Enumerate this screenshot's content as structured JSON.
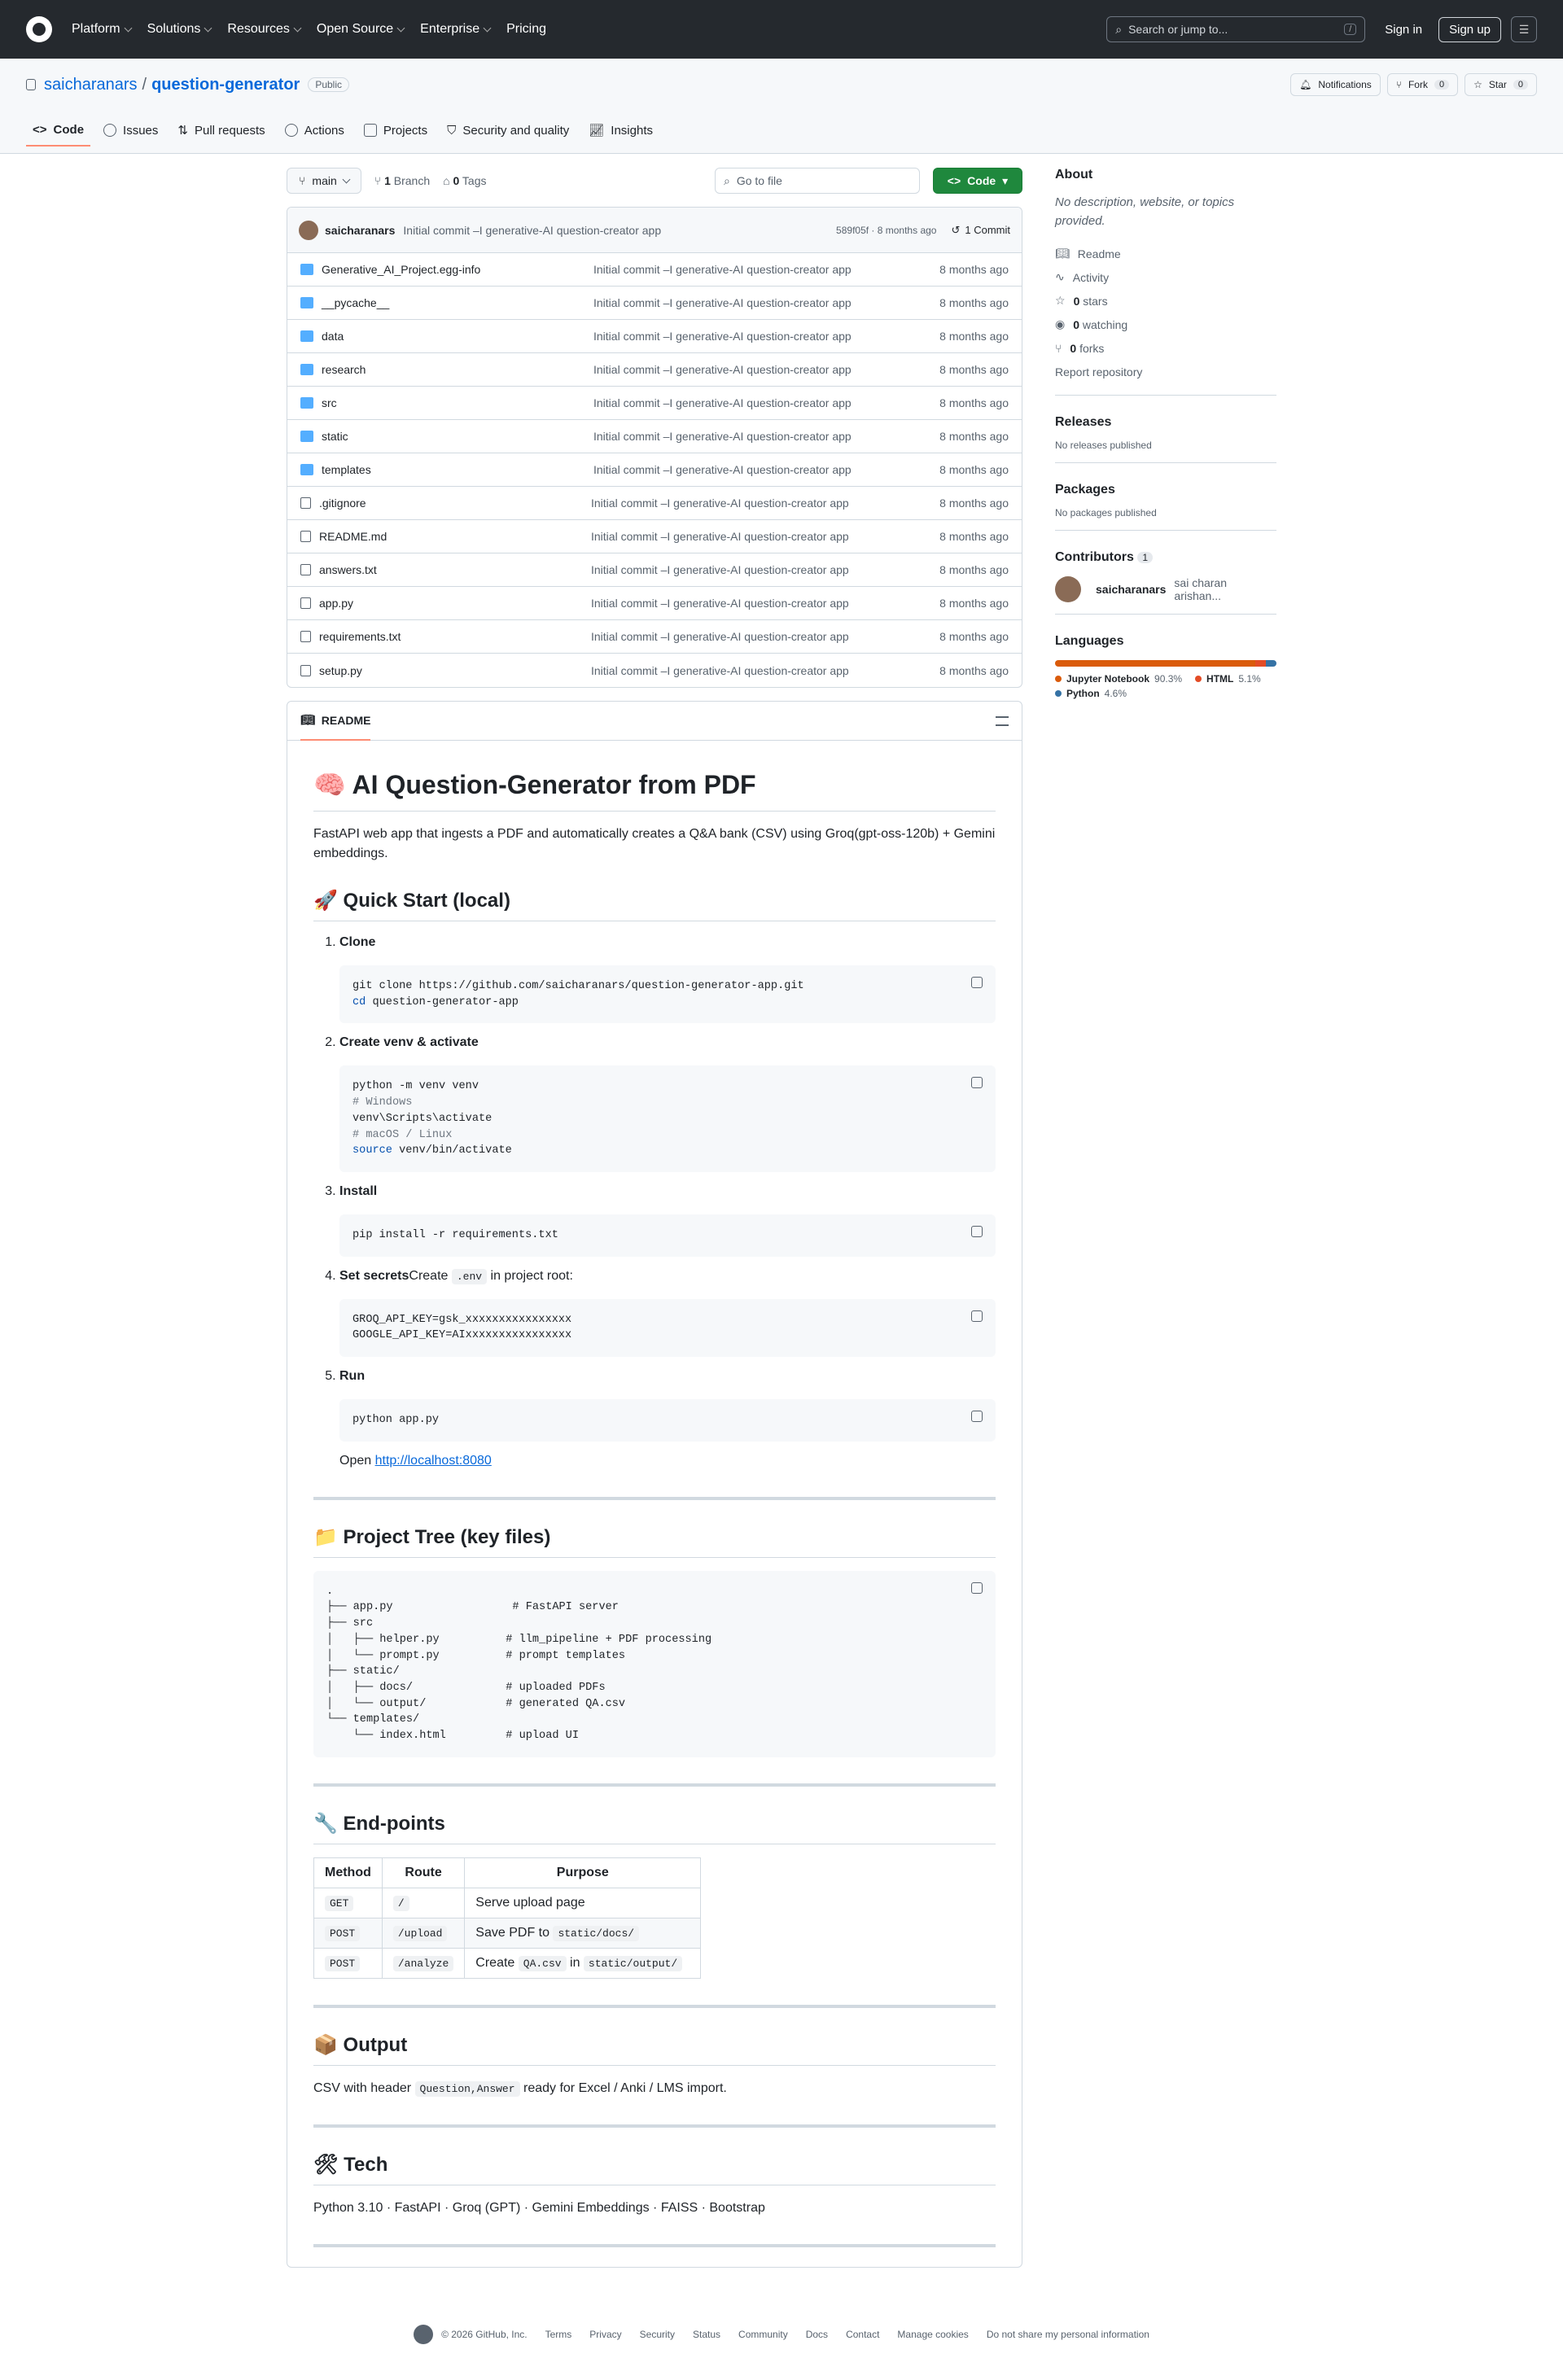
{
  "header": {
    "nav": [
      "Platform",
      "Solutions",
      "Resources",
      "Open Source",
      "Enterprise",
      "Pricing"
    ],
    "search_placeholder": "Search or jump to...",
    "search_kbd": "/",
    "sign_in": "Sign in",
    "sign_up": "Sign up"
  },
  "repo": {
    "owner": "saicharanars",
    "separator": "/",
    "name": "question-generator",
    "visibility": "Public",
    "notifications": "Notifications",
    "fork": "Fork",
    "fork_count": "0",
    "star": "Star",
    "star_count": "0",
    "tabs": [
      "Code",
      "Issues",
      "Pull requests",
      "Actions",
      "Projects",
      "Security and quality",
      "Insights"
    ]
  },
  "toolbar": {
    "branch": "main",
    "branches_count": "1",
    "branches_label": "Branch",
    "tags_count": "0",
    "tags_label": "Tags",
    "goto_placeholder": "Go to file",
    "code_button": "Code"
  },
  "commit": {
    "author": "saicharanars",
    "message": "Initial commit –I generative-AI question-creator app",
    "sha_time": "589f05f · 8 months ago",
    "count": "1 Commit"
  },
  "files": [
    {
      "name": "Generative_AI_Project.egg-info",
      "type": "dir",
      "msg": "Initial commit –I generative-AI question-creator app",
      "date": "8 months ago"
    },
    {
      "name": "__pycache__",
      "type": "dir",
      "msg": "Initial commit –I generative-AI question-creator app",
      "date": "8 months ago"
    },
    {
      "name": "data",
      "type": "dir",
      "msg": "Initial commit –I generative-AI question-creator app",
      "date": "8 months ago"
    },
    {
      "name": "research",
      "type": "dir",
      "msg": "Initial commit –I generative-AI question-creator app",
      "date": "8 months ago"
    },
    {
      "name": "src",
      "type": "dir",
      "msg": "Initial commit –I generative-AI question-creator app",
      "date": "8 months ago"
    },
    {
      "name": "static",
      "type": "dir",
      "msg": "Initial commit –I generative-AI question-creator app",
      "date": "8 months ago"
    },
    {
      "name": "templates",
      "type": "dir",
      "msg": "Initial commit –I generative-AI question-creator app",
      "date": "8 months ago"
    },
    {
      "name": ".gitignore",
      "type": "file",
      "msg": "Initial commit –I generative-AI question-creator app",
      "date": "8 months ago"
    },
    {
      "name": "README.md",
      "type": "file",
      "msg": "Initial commit –I generative-AI question-creator app",
      "date": "8 months ago"
    },
    {
      "name": "answers.txt",
      "type": "file",
      "msg": "Initial commit –I generative-AI question-creator app",
      "date": "8 months ago"
    },
    {
      "name": "app.py",
      "type": "file",
      "msg": "Initial commit –I generative-AI question-creator app",
      "date": "8 months ago"
    },
    {
      "name": "requirements.txt",
      "type": "file",
      "msg": "Initial commit –I generative-AI question-creator app",
      "date": "8 months ago"
    },
    {
      "name": "setup.py",
      "type": "file",
      "msg": "Initial commit –I generative-AI question-creator app",
      "date": "8 months ago"
    }
  ],
  "readme": {
    "tab": "README",
    "title": "🧠 AI Question-Generator from PDF",
    "intro": "FastAPI web app that ingests a PDF and automatically creates a Q&A bank (CSV) using Groq(gpt-oss-120b) + Gemini embeddings.",
    "quick_start": "🚀 Quick Start (local)",
    "step1": "Clone",
    "step2": "Create venv & activate",
    "step3": "Install",
    "step4_bold": "Set secrets",
    "step4_pre": "Create ",
    "step4_code": ".env",
    "step4_post": " in project root:",
    "step5": "Run",
    "code1_a": "git clone https://github.com/saicharanars/question-generator-app.git",
    "code1_kw": "cd",
    "code1_b": " question-generator-app",
    "code2_a": "python -m venv venv",
    "code2_c1": "# Windows",
    "code2_b": "venv\\Scripts\\activate",
    "code2_c2": "# macOS / Linux",
    "code2_kw": "source",
    "code2_d": " venv/bin/activate",
    "code3": "pip install -r requirements.txt",
    "code4": "GROQ_API_KEY=gsk_xxxxxxxxxxxxxxxx\nGOOGLE_API_KEY=AIxxxxxxxxxxxxxxxx",
    "code5": "python app.py",
    "open_text": "Open ",
    "open_link": "http://localhost:8080",
    "tree_title": "📁 Project Tree (key files)",
    "tree": ".\n├── app.py                  # FastAPI server\n├── src\n│   ├── helper.py          # llm_pipeline + PDF processing\n│   └── prompt.py          # prompt templates\n├── static/\n│   ├── docs/              # uploaded PDFs\n│   └── output/            # generated QA.csv\n└── templates/\n    └── index.html         # upload UI",
    "endpoints_title": "🔧 End-points",
    "table_headers": [
      "Method",
      "Route",
      "Purpose"
    ],
    "rows": [
      {
        "method": "GET",
        "route": "/",
        "purpose_a": "Serve upload page",
        "purpose_code": "",
        "purpose_b": "",
        "purpose_code2": ""
      },
      {
        "method": "POST",
        "route": "/upload",
        "purpose_a": "Save PDF to ",
        "purpose_code": "static/docs/",
        "purpose_b": "",
        "purpose_code2": ""
      },
      {
        "method": "POST",
        "route": "/analyze",
        "purpose_a": "Create ",
        "purpose_code": "QA.csv",
        "purpose_b": " in ",
        "purpose_code2": "static/output/"
      }
    ],
    "output_title": "📦 Output",
    "output_pre": "CSV with header ",
    "output_code": "Question,Answer",
    "output_post": " ready for Excel / Anki / LMS import.",
    "tech_title": "🛠 Tech",
    "tech": "Python 3.10 · FastAPI · Groq (GPT) · Gemini Embeddings · FAISS · Bootstrap"
  },
  "sidebar": {
    "about": "About",
    "description": "No description, website, or topics provided.",
    "readme": "Readme",
    "activity": "Activity",
    "stars_n": "0",
    "stars": "stars",
    "watching_n": "0",
    "watching": "watching",
    "forks_n": "0",
    "forks": "forks",
    "report": "Report repository",
    "releases": "Releases",
    "no_releases": "No releases published",
    "packages": "Packages",
    "no_packages": "No packages published",
    "contributors": "Contributors",
    "contributors_count": "1",
    "contrib_login": "saicharanars",
    "contrib_name": "sai charan arishan...",
    "languages": "Languages",
    "langs": [
      {
        "name": "Jupyter Notebook",
        "pct": "90.3%",
        "value": 90.3,
        "color": "#DA5B0B"
      },
      {
        "name": "HTML",
        "pct": "5.1%",
        "value": 5.1,
        "color": "#e34c26"
      },
      {
        "name": "Python",
        "pct": "4.6%",
        "value": 4.6,
        "color": "#3572A5"
      }
    ]
  },
  "footer": [
    "© 2026 GitHub, Inc.",
    "Terms",
    "Privacy",
    "Security",
    "Status",
    "Community",
    "Docs",
    "Contact",
    "Manage cookies",
    "Do not share my personal information"
  ]
}
